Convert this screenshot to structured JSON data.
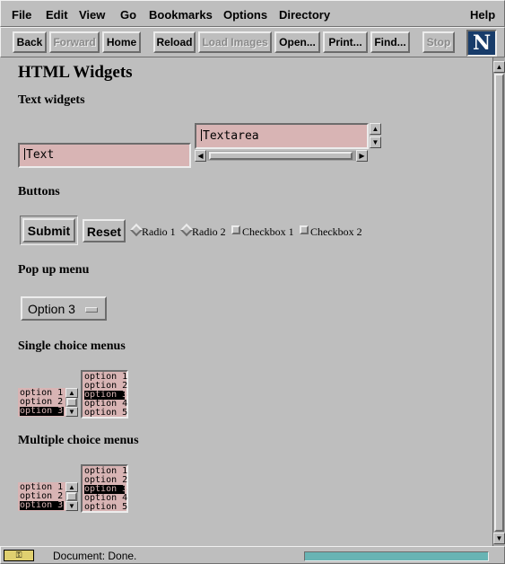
{
  "menu": {
    "items": [
      "File",
      "Edit",
      "View",
      "Go",
      "Bookmarks",
      "Options",
      "Directory"
    ],
    "help": "Help"
  },
  "toolbar": {
    "back": "Back",
    "forward": "Forward",
    "home": "Home",
    "reload": "Reload",
    "load_images": "Load Images",
    "open": "Open...",
    "print": "Print...",
    "find": "Find...",
    "stop": "Stop",
    "logo": "N"
  },
  "page": {
    "title": "HTML Widgets",
    "text_widgets": {
      "heading": "Text widgets",
      "text_value": "Text",
      "textarea_value": "Textarea"
    },
    "buttons": {
      "heading": "Buttons",
      "submit": "Submit",
      "reset": "Reset",
      "radio1": "Radio 1",
      "radio2": "Radio 2",
      "checkbox1": "Checkbox 1",
      "checkbox2": "Checkbox 2"
    },
    "popup": {
      "heading": "Pop up menu",
      "selected": "Option 3"
    },
    "single_choice": {
      "heading": "Single choice menus",
      "list_a": {
        "options": [
          "option 1",
          "option 2",
          "option 3"
        ],
        "selected": 2
      },
      "list_b": {
        "options": [
          "option 1",
          "option 2",
          "option 3",
          "option 4",
          "option 5"
        ],
        "selected": 2
      }
    },
    "multiple_choice": {
      "heading": "Multiple choice menus",
      "list_a": {
        "options": [
          "option 1",
          "option 2",
          "option 3"
        ],
        "selected": 2
      },
      "list_b": {
        "options": [
          "option 1",
          "option 2",
          "option 3",
          "option 4",
          "option 5"
        ],
        "selected": 2
      }
    }
  },
  "status": {
    "text": "Document: Done.",
    "progress_color": "#68b4b4"
  },
  "colors": {
    "chrome": "#bebebe",
    "field": "#d8b4b4",
    "logo_bg": "#183c6a"
  }
}
